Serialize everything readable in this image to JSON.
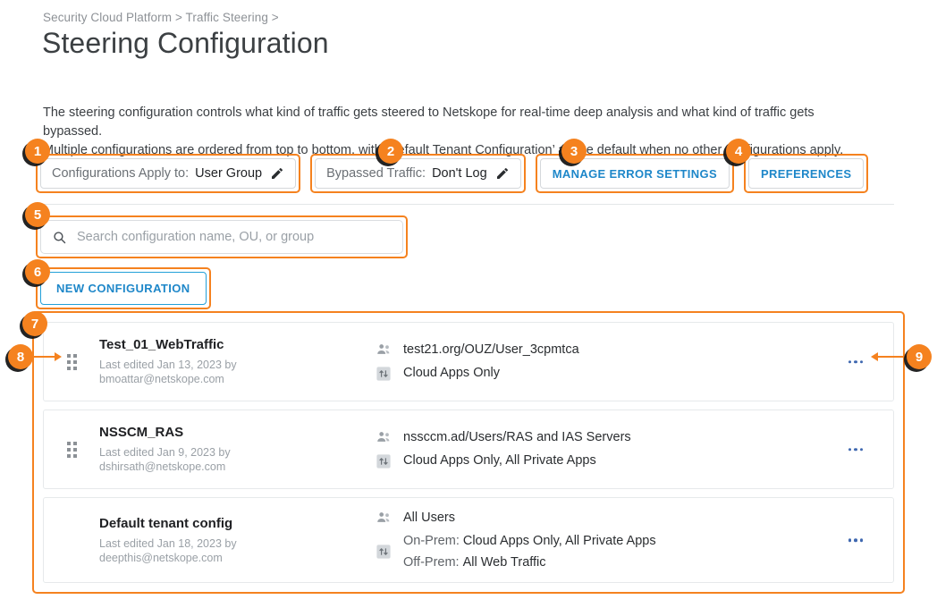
{
  "breadcrumb": {
    "items": [
      "Security Cloud Platform",
      "Traffic Steering"
    ],
    "separator": ">",
    "full": "Security Cloud Platform > Traffic Steering >"
  },
  "page_title": "Steering Configuration",
  "description": {
    "line1": "The steering configuration controls what kind of traffic gets steered to Netskope for real-time deep analysis and what kind of traffic gets bypassed.",
    "line2": "Multiple configurations are ordered from top to bottom, with ‘Default Tenant Configuration’ as the default when no other configurations apply."
  },
  "toolbar": {
    "configurations_apply_to": {
      "label": "Configurations Apply to:",
      "value": "User Group",
      "edit_icon": "pencil-icon"
    },
    "bypassed_traffic": {
      "label": "Bypassed Traffic:",
      "value": "Don't Log",
      "edit_icon": "pencil-icon"
    },
    "manage_error_settings": "MANAGE ERROR SETTINGS",
    "preferences": "PREFERENCES"
  },
  "search": {
    "placeholder": "Search configuration name, OU, or group",
    "value": "",
    "icon": "search-icon"
  },
  "new_configuration_button": "NEW CONFIGURATION",
  "configurations": [
    {
      "name": "Test_01_WebTraffic",
      "last_edited_line1": "Last edited Jan 13, 2023 by",
      "last_edited_line2": "bmoattar@netskope.com",
      "users_icon": "users-icon",
      "users": "test21.org/OUZ/User_3cpmtca",
      "traffic_icon": "traffic-steering-icon",
      "traffic": [
        {
          "key": "",
          "value": "Cloud Apps Only"
        }
      ],
      "menu_icon": "kebab-menu-icon"
    },
    {
      "name": "NSSCM_RAS",
      "last_edited_line1": "Last edited Jan 9, 2023 by",
      "last_edited_line2": "dshirsath@netskope.com",
      "users_icon": "users-icon",
      "users": "nssccm.ad/Users/RAS and IAS Servers",
      "traffic_icon": "traffic-steering-icon",
      "traffic": [
        {
          "key": "",
          "value": "Cloud Apps Only, All Private Apps"
        }
      ],
      "menu_icon": "kebab-menu-icon"
    },
    {
      "name": "Default tenant config",
      "last_edited_line1": "Last edited Jan 18, 2023 by",
      "last_edited_line2": "deepthis@netskope.com",
      "users_icon": "users-icon",
      "users": "All Users",
      "traffic_icon": "traffic-steering-icon",
      "traffic": [
        {
          "key": "On-Prem:",
          "value": "Cloud Apps Only, All Private Apps"
        },
        {
          "key": "Off-Prem:",
          "value": "All Web Traffic"
        }
      ],
      "menu_icon": "kebab-menu-icon"
    }
  ],
  "annotations": {
    "badges": [
      "1",
      "2",
      "3",
      "4",
      "5",
      "6",
      "7",
      "8",
      "9"
    ]
  },
  "colors": {
    "accent_orange": "#f5821f",
    "link_blue": "#1e87c9",
    "text_dark": "#202124",
    "text_muted": "#9aa0a6",
    "border": "#e6e9eb"
  }
}
